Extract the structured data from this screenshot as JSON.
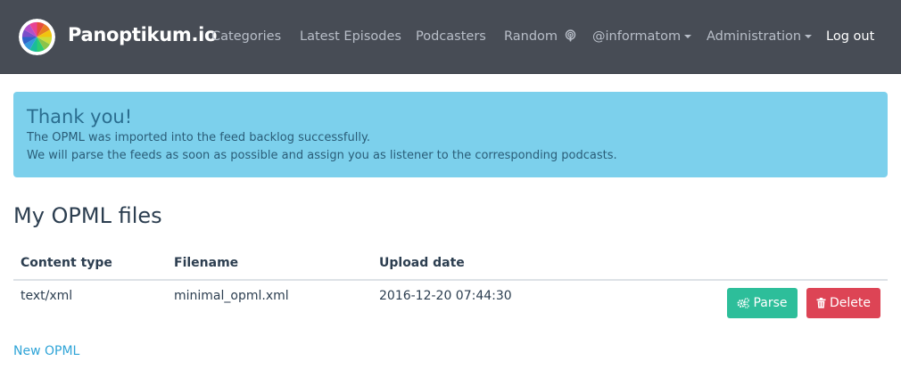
{
  "brand": {
    "name": "Panoptikum.io",
    "logo_icon": "color-wheel-logo"
  },
  "nav": {
    "categories": "Categories",
    "latest_episodes": "Latest Episodes",
    "podcasters": "Podcasters",
    "random": "Random",
    "user": "@informatom",
    "administration": "Administration",
    "logout": "Log out"
  },
  "alert": {
    "title": "Thank you!",
    "line1": "The OPML was imported into the feed backlog successfully.",
    "line2": "We will parse the feeds as soon as possible and assign you as listener to the corresponding podcasts.",
    "color": "#7cd0ec"
  },
  "page": {
    "title": "My OPML files"
  },
  "table": {
    "headers": {
      "content_type": "Content type",
      "filename": "Filename",
      "upload_date": "Upload date"
    },
    "rows": [
      {
        "content_type": "text/xml",
        "filename": "minimal_opml.xml",
        "upload_date": "2016-12-20 07:44:30"
      }
    ],
    "actions": {
      "parse": "Parse",
      "delete": "Delete"
    }
  },
  "new_opml": "New OPML",
  "colors": {
    "navbar": "#474c55",
    "parse": "#2dbe9a",
    "delete": "#dd4455",
    "link": "#2fa4d7"
  }
}
